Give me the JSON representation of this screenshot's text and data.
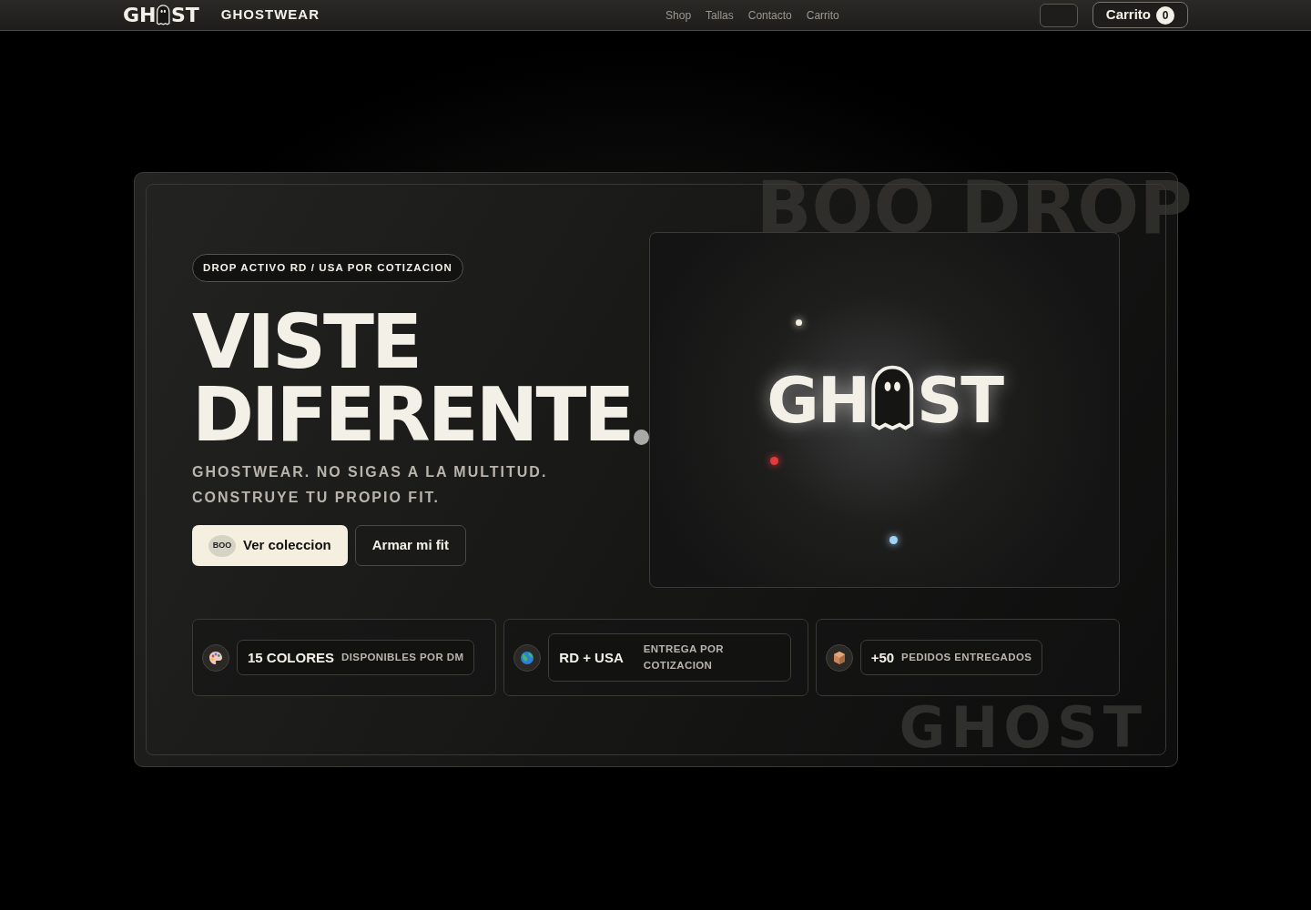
{
  "header": {
    "logo": {
      "left": "GH",
      "right": "ST"
    },
    "brand": "GHOSTWEAR",
    "nav": [
      {
        "label": "Shop"
      },
      {
        "label": "Tallas"
      },
      {
        "label": "Contacto"
      },
      {
        "label": "Carrito"
      }
    ],
    "cart": {
      "label": "Carrito",
      "count": "0"
    }
  },
  "hero": {
    "badge": "DROP ACTIVO RD / USA POR COTIZACION",
    "title_lines": [
      "VISTE",
      "DIFERENTE"
    ],
    "subtitle_lines": [
      "GHOSTWEAR. NO SIGAS A LA MULTITUD.",
      "CONSTRUYE TU PROPIO FIT."
    ],
    "buttons": [
      {
        "kind": "primary",
        "tag": "BOO",
        "label": "Ver coleccion"
      },
      {
        "kind": "outline",
        "label": "Armar mi fit"
      }
    ]
  },
  "watermarks": [
    "BOO DROP",
    "GHOST"
  ],
  "art": {
    "logo": {
      "left": "GH",
      "right": "ST"
    }
  },
  "stats": [
    {
      "kind": "palette",
      "value": "15 COLORES",
      "label": "DISPONIBLES POR DM"
    },
    {
      "kind": "globe",
      "value": "RD + USA",
      "label": "ENTREGA POR COTIZACION"
    },
    {
      "kind": "box",
      "value": "+50",
      "label": "PEDIDOS ENTREGADOS"
    }
  ]
}
